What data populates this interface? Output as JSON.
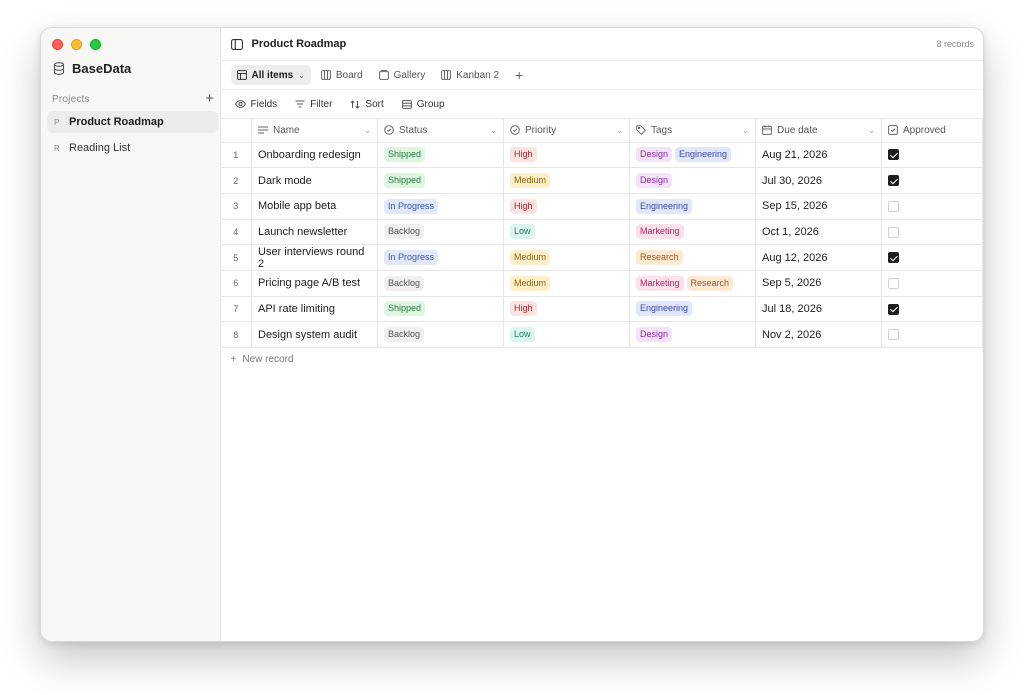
{
  "app": {
    "brand": "BaseData"
  },
  "sidebar": {
    "section_label": "Projects",
    "add_symbol": "+",
    "items": [
      {
        "letter": "P",
        "label": "Product Roadmap",
        "active": true
      },
      {
        "letter": "R",
        "label": "Reading List",
        "active": false
      }
    ]
  },
  "header": {
    "title": "Product Roadmap",
    "records": "8 records"
  },
  "views": [
    {
      "label": "All items",
      "active": true
    },
    {
      "label": "Board",
      "active": false
    },
    {
      "label": "Gallery",
      "active": false
    },
    {
      "label": "Kanban 2",
      "active": false
    }
  ],
  "view_add": "+",
  "toolbar": {
    "fields": "Fields",
    "filter": "Filter",
    "sort": "Sort",
    "group": "Group"
  },
  "columns": {
    "name": "Name",
    "status": "Status",
    "priority": "Priority",
    "tags": "Tags",
    "due": "Due date",
    "approved": "Approved"
  },
  "rows": [
    {
      "num": "1",
      "name": "Onboarding redesign",
      "status": "Shipped",
      "priority": "High",
      "tags": [
        "Design",
        "Engineering"
      ],
      "due": "Aug 21, 2026",
      "approved": true
    },
    {
      "num": "2",
      "name": "Dark mode",
      "status": "Shipped",
      "priority": "Medium",
      "tags": [
        "Design"
      ],
      "due": "Jul 30, 2026",
      "approved": true
    },
    {
      "num": "3",
      "name": "Mobile app beta",
      "status": "In Progress",
      "priority": "High",
      "tags": [
        "Engineering"
      ],
      "due": "Sep 15, 2026",
      "approved": false
    },
    {
      "num": "4",
      "name": "Launch newsletter",
      "status": "Backlog",
      "priority": "Low",
      "tags": [
        "Marketing"
      ],
      "due": "Oct 1, 2026",
      "approved": false
    },
    {
      "num": "5",
      "name": "User interviews round 2",
      "status": "In Progress",
      "priority": "Medium",
      "tags": [
        "Research"
      ],
      "due": "Aug 12, 2026",
      "approved": true
    },
    {
      "num": "6",
      "name": "Pricing page A/B test",
      "status": "Backlog",
      "priority": "Medium",
      "tags": [
        "Marketing",
        "Research"
      ],
      "due": "Sep 5, 2026",
      "approved": false
    },
    {
      "num": "7",
      "name": "API rate limiting",
      "status": "Shipped",
      "priority": "High",
      "tags": [
        "Engineering"
      ],
      "due": "Jul 18, 2026",
      "approved": true
    },
    {
      "num": "8",
      "name": "Design system audit",
      "status": "Backlog",
      "priority": "Low",
      "tags": [
        "Design"
      ],
      "due": "Nov 2, 2026",
      "approved": false
    }
  ],
  "new_record": "New record",
  "colors": {
    "traffic_red": "#ff5f57",
    "traffic_yellow": "#febc2e",
    "traffic_green": "#28c840",
    "status_shipped": "#dff5e4",
    "status_in_progress": "#e1e8fb",
    "status_backlog": "#efefee",
    "priority_high": "#fde2e2",
    "priority_medium": "#fdf0c9",
    "priority_low": "#d9f5ee"
  }
}
